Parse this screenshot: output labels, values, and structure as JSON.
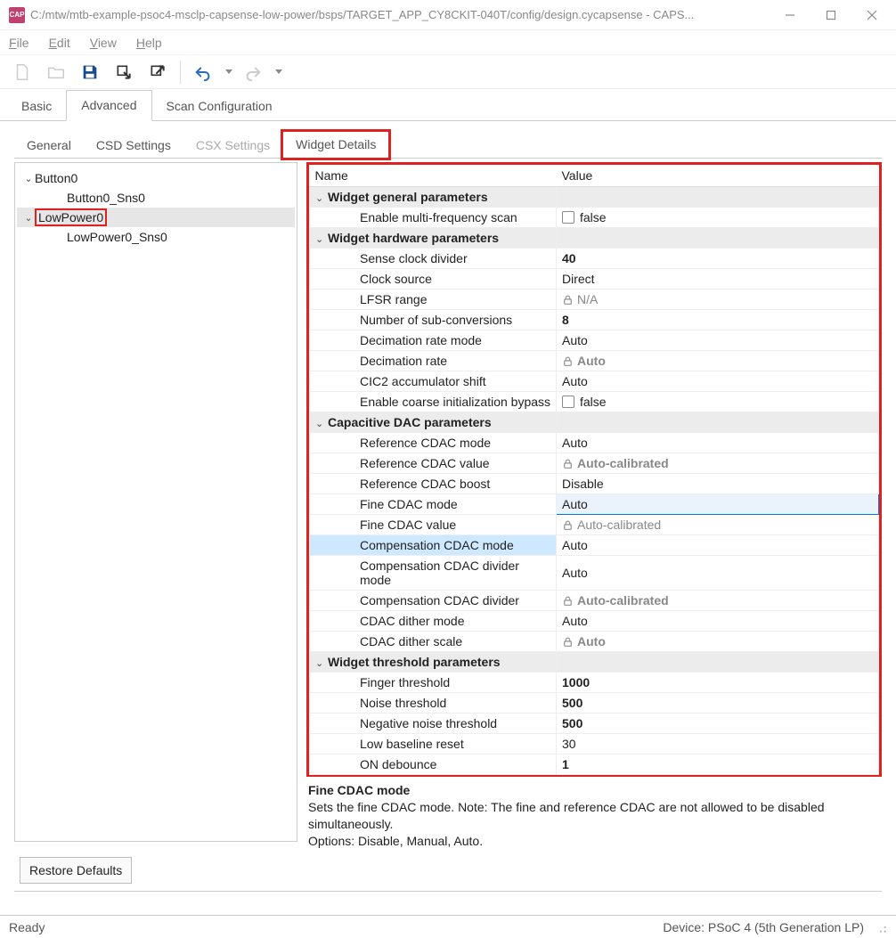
{
  "window": {
    "title": "C:/mtw/mtb-example-psoc4-msclp-capsense-low-power/bsps/TARGET_APP_CY8CKIT-040T/config/design.cycapsense - CAPS...",
    "app_icon_label": "CAP"
  },
  "menubar": [
    "File",
    "Edit",
    "View",
    "Help"
  ],
  "toolbar": {
    "new": "new-file-icon",
    "open": "open-folder-icon",
    "save": "save-icon",
    "import": "import-icon",
    "export": "export-icon",
    "undo": "undo-icon",
    "redo": "redo-icon"
  },
  "main_tabs": {
    "items": [
      "Basic",
      "Advanced",
      "Scan Configuration"
    ],
    "active": 1
  },
  "sub_tabs": {
    "items": [
      "General",
      "CSD Settings",
      "CSX Settings",
      "Widget Details"
    ],
    "active": 3,
    "disabled_index": 2
  },
  "tree": [
    {
      "label": "Button0",
      "depth": 1,
      "exp": true
    },
    {
      "label": "Button0_Sns0",
      "depth": 2
    },
    {
      "label": "LowPower0",
      "depth": 1,
      "exp": true,
      "selected": true,
      "highlight": true
    },
    {
      "label": "LowPower0_Sns0",
      "depth": 2
    }
  ],
  "param_headers": {
    "name": "Name",
    "value": "Value"
  },
  "params": {
    "groups": [
      {
        "title": "Widget general parameters",
        "rows": [
          {
            "name": "Enable multi-frequency scan",
            "value": "false",
            "type": "checkbox"
          }
        ]
      },
      {
        "title": "Widget hardware parameters",
        "rows": [
          {
            "name": "Sense clock divider",
            "value": "40",
            "bold": true
          },
          {
            "name": "Clock source",
            "value": "Direct"
          },
          {
            "name": "LFSR range",
            "value": "N/A",
            "locked": true,
            "normal": true
          },
          {
            "name": "Number of sub-conversions",
            "value": "8",
            "bold": true
          },
          {
            "name": "Decimation rate mode",
            "value": "Auto"
          },
          {
            "name": "Decimation rate",
            "value": "Auto",
            "locked": true
          },
          {
            "name": "CIC2 accumulator shift",
            "value": "Auto"
          },
          {
            "name": "Enable coarse initialization bypass",
            "value": "false",
            "type": "checkbox"
          }
        ]
      },
      {
        "title": "Capacitive DAC parameters",
        "rows": [
          {
            "name": "Reference CDAC mode",
            "value": "Auto"
          },
          {
            "name": "Reference CDAC value",
            "value": "Auto-calibrated",
            "locked": true
          },
          {
            "name": "Reference CDAC boost",
            "value": "Disable"
          },
          {
            "name": "Fine CDAC mode",
            "value": "Auto",
            "value_selected": true
          },
          {
            "name": "Fine CDAC value",
            "value": "Auto-calibrated",
            "locked": true,
            "normal": true
          },
          {
            "name": "Compensation CDAC mode",
            "value": "Auto",
            "name_selected": true
          },
          {
            "name": "Compensation CDAC divider mode",
            "value": "Auto"
          },
          {
            "name": "Compensation CDAC divider",
            "value": "Auto-calibrated",
            "locked": true
          },
          {
            "name": "CDAC dither mode",
            "value": "Auto"
          },
          {
            "name": "CDAC dither scale",
            "value": "Auto",
            "locked": true
          }
        ]
      },
      {
        "title": "Widget threshold parameters",
        "rows": [
          {
            "name": "Finger threshold",
            "value": "1000",
            "bold": true
          },
          {
            "name": "Noise threshold",
            "value": "500",
            "bold": true
          },
          {
            "name": "Negative noise threshold",
            "value": "500",
            "bold": true
          },
          {
            "name": "Low baseline reset",
            "value": "30"
          },
          {
            "name": "ON debounce",
            "value": "1",
            "bold": true
          }
        ]
      }
    ]
  },
  "description": {
    "title": "Fine CDAC mode",
    "body": "Sets the fine CDAC mode. Note: The fine and reference CDAC are not allowed to be disabled simultaneously.",
    "options": "Options: Disable, Manual, Auto."
  },
  "restore_label": "Restore Defaults",
  "status": {
    "left": "Ready",
    "right": "Device: PSoC 4 (5th Generation LP)"
  }
}
